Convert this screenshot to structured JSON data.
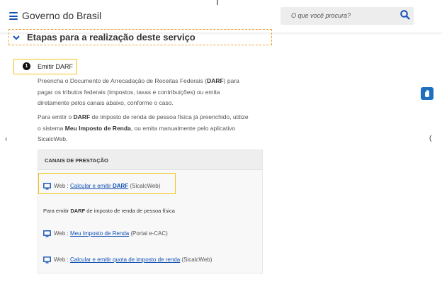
{
  "header": {
    "brand": "Governo do Brasil",
    "search_placeholder": "O que você procura?"
  },
  "section": {
    "title": "Etapas para a realização deste serviço"
  },
  "step": {
    "number": "1",
    "label": "Emitir DARF"
  },
  "paragraph1": {
    "pre": "Preencha o Documento de Arrecadação de Receitas Federais (",
    "bold": "DARF",
    "post_line1": ") para",
    "line2": "pagar os tributos federais (impostos, taxas e contribuições) ou emita",
    "line3": "diretamente pelos canais abaixo, conforme o caso."
  },
  "paragraph2": {
    "pre": "Para emitir o ",
    "bold1": "DARF",
    "post1": " de imposto de renda de pessoa física já preenchido, utilize",
    "line2_pre": "o sistema ",
    "bold2": "Meu Imposto de Renda",
    "line2_post": ", ou emita manualmente pelo aplicativo",
    "line3": "SicalcWeb."
  },
  "panel": {
    "heading": "CANAIS DE PRESTAÇÃO",
    "channel1": {
      "prefix": "Web : ",
      "link_pre": "Calcular e emitir ",
      "link_bold": "DARF",
      "suffix": " (SicalcWeb)"
    },
    "subheading_pre": "Para emitir ",
    "subheading_bold": "DARF",
    "subheading_post": " de imposto de renda de pessoa física",
    "channel2": {
      "prefix": "Web : ",
      "link": "Meu Imposto de Renda",
      "suffix": " (Portal e-CAC)"
    },
    "channel3": {
      "prefix": "Web : ",
      "link": "Calcular e emitir quota de imposto de renda",
      "suffix": " (SicalcWeb)"
    }
  },
  "edges": {
    "left": "‹",
    "right": "("
  },
  "colors": {
    "primary": "#1351b4",
    "highlight": "#f2c318",
    "section_border": "#f2a33a"
  }
}
